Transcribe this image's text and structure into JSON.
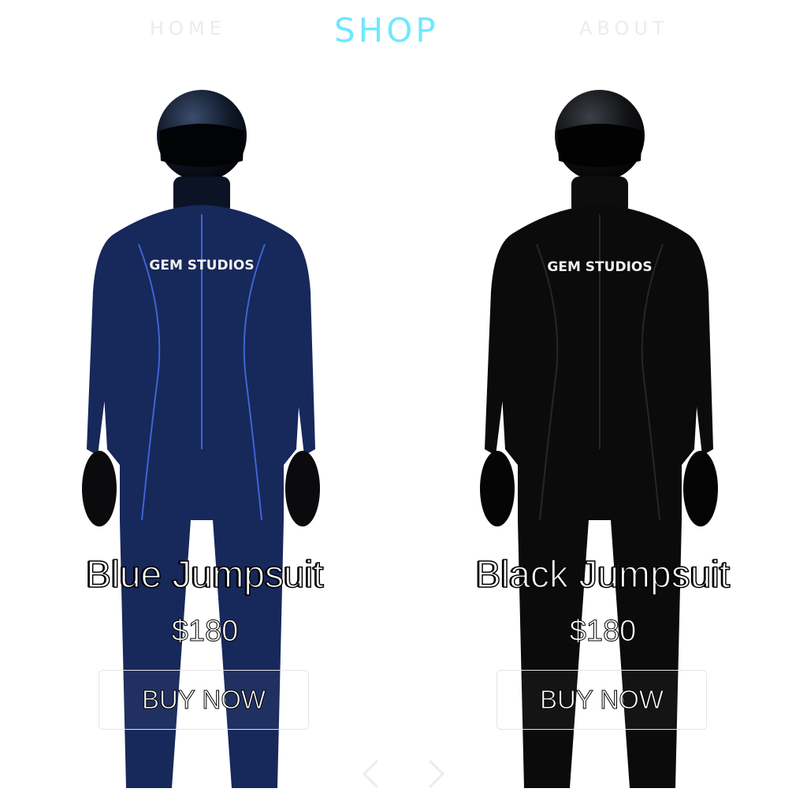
{
  "nav": {
    "home_label": "HOME",
    "shop_label": "SHOP",
    "about_label": "ABOUT"
  },
  "products": [
    {
      "name": "Blue Jumpsuit",
      "price": "$180",
      "buy_label": "BUY NOW",
      "brand_print": "GEM STUDIOS",
      "suit_color": "#17285a",
      "piping_color": "#3f63d8"
    },
    {
      "name": "Black Jumpsuit",
      "price": "$180",
      "buy_label": "BUY NOW",
      "brand_print": "GEM STUDIOS",
      "suit_color": "#0b0b0b",
      "piping_color": "#262626"
    }
  ],
  "carousel": {
    "prev_icon": "chevron-left-icon",
    "next_icon": "chevron-right-icon"
  },
  "colors": {
    "accent": "#6ee9ff",
    "nav_inactive": "#ececec",
    "background": "#ffffff"
  }
}
